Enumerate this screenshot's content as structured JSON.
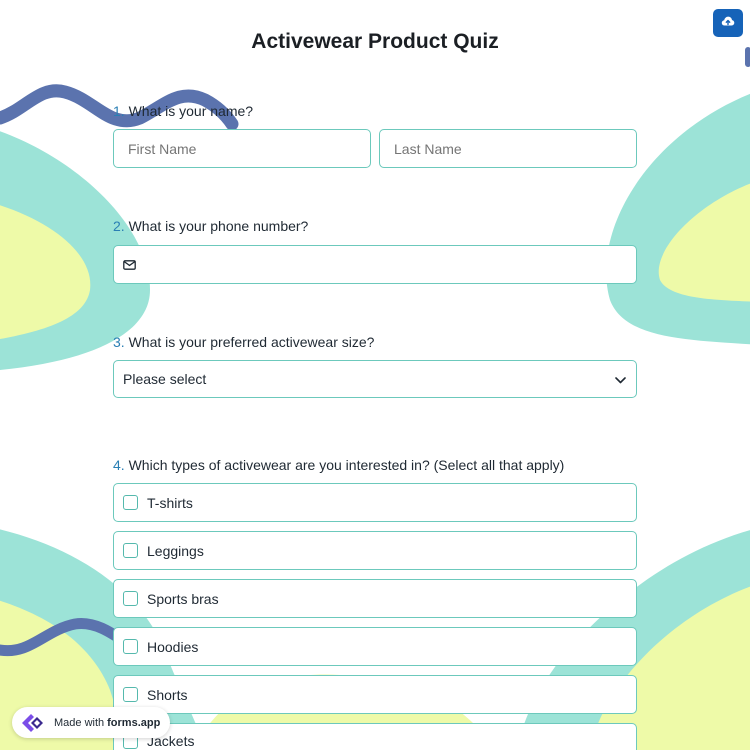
{
  "form": {
    "title": "Activewear Product Quiz"
  },
  "toolbar": {
    "save_icon": "cloud-upload-icon"
  },
  "questions": [
    {
      "number": "1.",
      "label": "What is your name?",
      "fields": [
        {
          "placeholder": "First Name",
          "value": ""
        },
        {
          "placeholder": "Last Name",
          "value": ""
        }
      ]
    },
    {
      "number": "2.",
      "label": "What is your phone number?",
      "icon": "mail-icon",
      "value": ""
    },
    {
      "number": "3.",
      "label": "What is your preferred activewear size?",
      "selected": "Please select",
      "icon": "chevron-down-icon"
    },
    {
      "number": "4.",
      "label": "Which types of activewear are you interested in? (Select all that apply)",
      "options": [
        {
          "label": "T-shirts",
          "checked": false
        },
        {
          "label": "Leggings",
          "checked": false
        },
        {
          "label": "Sports bras",
          "checked": false
        },
        {
          "label": "Hoodies",
          "checked": false
        },
        {
          "label": "Shorts",
          "checked": false
        },
        {
          "label": "Jackets",
          "checked": false
        }
      ]
    }
  ],
  "badge": {
    "prefix": "Made with",
    "brand": "forms.app",
    "icon": "forms-app-logo-icon"
  },
  "colors": {
    "accent": "#1663b8",
    "border": "#6cc9bc",
    "teal_shape": "#9ce3d7",
    "yellow_shape": "#eefaa8",
    "navy_stroke": "#5b73ae",
    "question_number": "#2a7fb4"
  }
}
